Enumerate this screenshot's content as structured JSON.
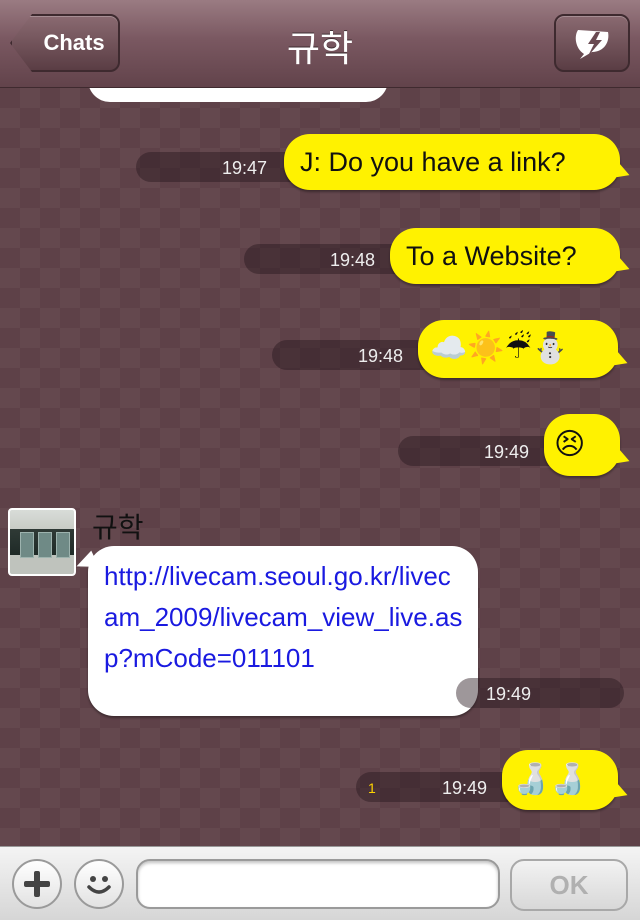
{
  "header": {
    "back_label": "Chats",
    "title": "규학",
    "action_icon": "lightning-icon"
  },
  "messages": [
    {
      "side": "me",
      "time": "19:47",
      "text": "J: Do you have a link?"
    },
    {
      "side": "me",
      "time": "19:48",
      "text": "To a Website?"
    },
    {
      "side": "me",
      "time": "19:48",
      "emoji": "☁️☀️☔⛄"
    },
    {
      "side": "me",
      "time": "19:49",
      "emoji": "😣"
    },
    {
      "side": "them",
      "sender": "규학",
      "time": "19:49",
      "text": "http://livecam.seoul.go.kr/livecam_2009/livecam_view_live.asp?mCode=011101"
    },
    {
      "side": "me",
      "time": "19:49",
      "unread": "1",
      "emoji": "🍶🍶"
    }
  ],
  "inputbar": {
    "add_icon": "plus-icon",
    "emoji_icon": "smiley-icon",
    "placeholder": "",
    "send_label": "OK"
  },
  "colors": {
    "header": "#7a5861",
    "background": "#5e4148",
    "my_bubble": "#fff200",
    "their_bubble": "#ffffff",
    "link": "#1a1ae0"
  }
}
